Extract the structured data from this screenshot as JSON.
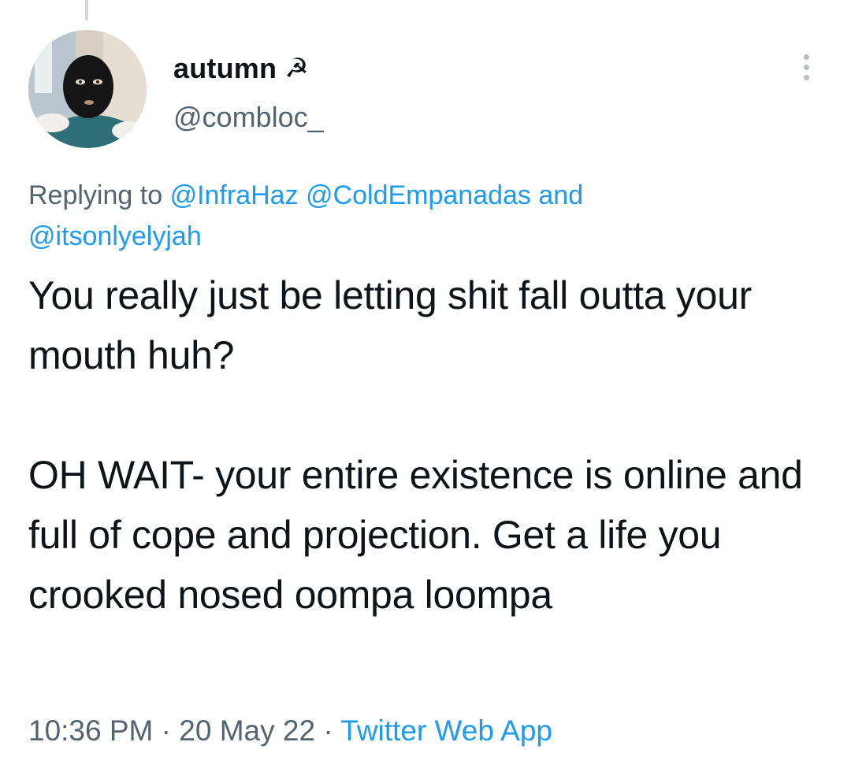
{
  "tweet": {
    "author": {
      "display_name": "autumn",
      "name_emoji": "☭",
      "handle": "@combloc_",
      "avatar_icon": "avatar-balaclava-icon"
    },
    "reply_context": {
      "prefix": "Replying to",
      "mentions": [
        "@InfraHaz",
        "@ColdEmpanadas"
      ],
      "conjunction": "and",
      "last_mention": "@itsonlyelyjah"
    },
    "body": {
      "paragraph_1": "You really just be letting shit fall outta your mouth huh?",
      "paragraph_2": "OH WAIT- your entire existence is online and full of cope and projection.  Get a life you crooked nosed oompa loompa"
    },
    "meta": {
      "time": "10:36 PM",
      "separator": "·",
      "date": "20 May 22",
      "source": "Twitter Web App"
    },
    "more_menu_icon": "more-options-icon"
  },
  "colors": {
    "text_primary": "#0f1419",
    "text_secondary": "#536471",
    "link": "#1d9bf0",
    "thread_line": "#cfd9de",
    "background": "#ffffff"
  }
}
